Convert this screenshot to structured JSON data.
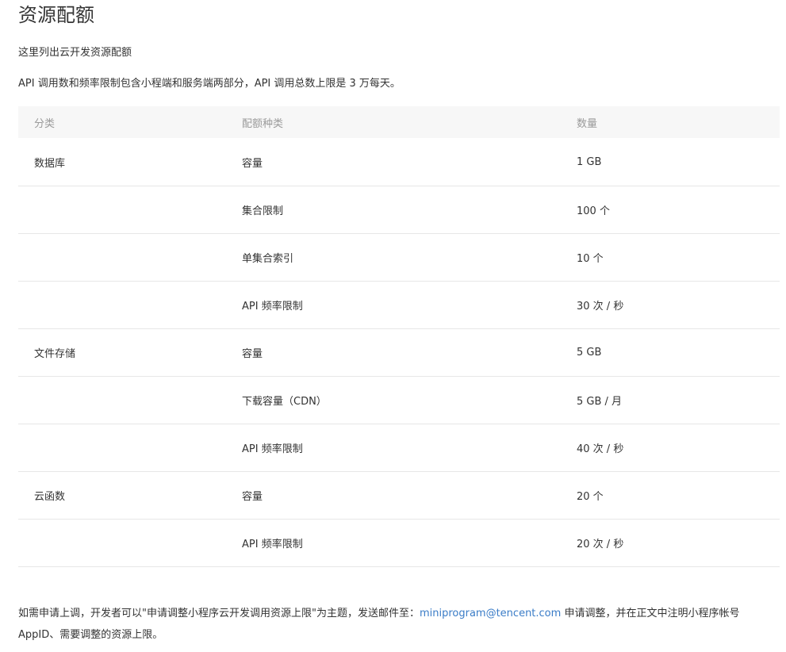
{
  "page": {
    "title": "资源配额",
    "intro_1": "这里列出云开发资源配额",
    "intro_2": "API 调用数和频率限制包含小程端和服务端两部分，API 调用总数上限是 3 万每天。"
  },
  "table": {
    "headers": [
      "分类",
      "配额种类",
      "数量"
    ],
    "rows": [
      {
        "category": "数据库",
        "type": "容量",
        "amount": "1 GB"
      },
      {
        "category": "",
        "type": "集合限制",
        "amount": "100 个"
      },
      {
        "category": "",
        "type": "单集合索引",
        "amount": "10 个"
      },
      {
        "category": "",
        "type": "API 频率限制",
        "amount": "30 次 / 秒"
      },
      {
        "category": "文件存储",
        "type": "容量",
        "amount": "5 GB"
      },
      {
        "category": "",
        "type": "下载容量（CDN）",
        "amount": "5 GB / 月"
      },
      {
        "category": "",
        "type": "API 频率限制",
        "amount": "40 次 / 秒"
      },
      {
        "category": "云函数",
        "type": "容量",
        "amount": "20 个"
      },
      {
        "category": "",
        "type": "API 频率限制",
        "amount": "20 次 / 秒"
      }
    ]
  },
  "footer": {
    "text_before": "如需申请上调，开发者可以\"申请调整小程序云开发调用资源上限\"为主题，发送邮件至：",
    "email": "miniprogram@tencent.com",
    "text_after": " 申请调整，并在正文中注明小程序帐号 AppID、需要调整的资源上限。"
  },
  "colors": {
    "link": "#3a7cc7",
    "header_bg": "#f7f7f7",
    "header_text": "#9a9a9a",
    "row_border": "#e7e7e7"
  }
}
